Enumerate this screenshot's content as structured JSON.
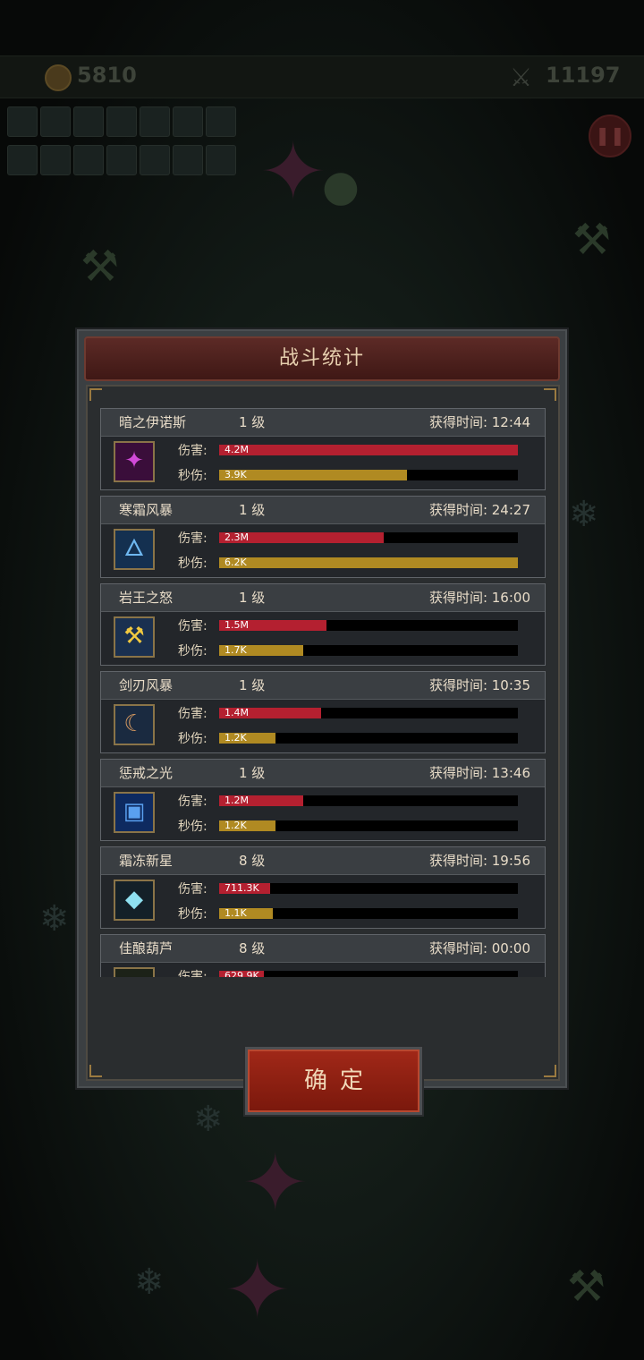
{
  "hud": {
    "gold": "5810",
    "kills": "11197",
    "pause_icon": "pause-icon",
    "coin_icon": "coin-icon",
    "kill_icon": "crossed-swords-icon"
  },
  "dialog": {
    "title": "战斗统计",
    "damage_label": "伤害:",
    "dps_label": "秒伤:",
    "time_prefix": "获得时间:",
    "confirm_label": "确定",
    "skills": [
      {
        "name": "暗之伊诺斯",
        "level": "1 级",
        "time": "获得时间:  12:44",
        "damage": "4.2M",
        "dps": "3.9K",
        "damage_ratio": 1.0,
        "dps_ratio": 0.63,
        "icon": "shuriken-icon"
      },
      {
        "name": "寒霜风暴",
        "level": "1 级",
        "time": "获得时间:  24:27",
        "damage": "2.3M",
        "dps": "6.2K",
        "damage_ratio": 0.55,
        "dps_ratio": 1.0,
        "icon": "frost-trident-icon"
      },
      {
        "name": "岩王之怒",
        "level": "1 级",
        "time": "获得时间:  16:00",
        "damage": "1.5M",
        "dps": "1.7K",
        "damage_ratio": 0.36,
        "dps_ratio": 0.28,
        "icon": "hammer-icon"
      },
      {
        "name": "剑刃风暴",
        "level": "1 级",
        "time": "获得时间:  10:35",
        "damage": "1.4M",
        "dps": "1.2K",
        "damage_ratio": 0.34,
        "dps_ratio": 0.19,
        "icon": "blade-icon"
      },
      {
        "name": "惩戒之光",
        "level": "1 级",
        "time": "获得时间:  13:46",
        "damage": "1.2M",
        "dps": "1.2K",
        "damage_ratio": 0.28,
        "dps_ratio": 0.19,
        "icon": "holy-book-icon"
      },
      {
        "name": "霜冻新星",
        "level": "8 级",
        "time": "获得时间:  19:56",
        "damage": "711.3K",
        "dps": "1.1K",
        "damage_ratio": 0.17,
        "dps_ratio": 0.18,
        "icon": "ice-crystal-icon"
      },
      {
        "name": "佳酿葫芦",
        "level": "8 级",
        "time": "获得时间:  00:00",
        "damage": "629.9K",
        "dps": "",
        "damage_ratio": 0.15,
        "dps_ratio": 0.0,
        "icon": "gourd-icon"
      }
    ]
  },
  "colors": {
    "damage_bar": "#b42030",
    "dps_bar": "#b08a22",
    "header": "#5c2a26",
    "confirm_button": "#a12818"
  }
}
